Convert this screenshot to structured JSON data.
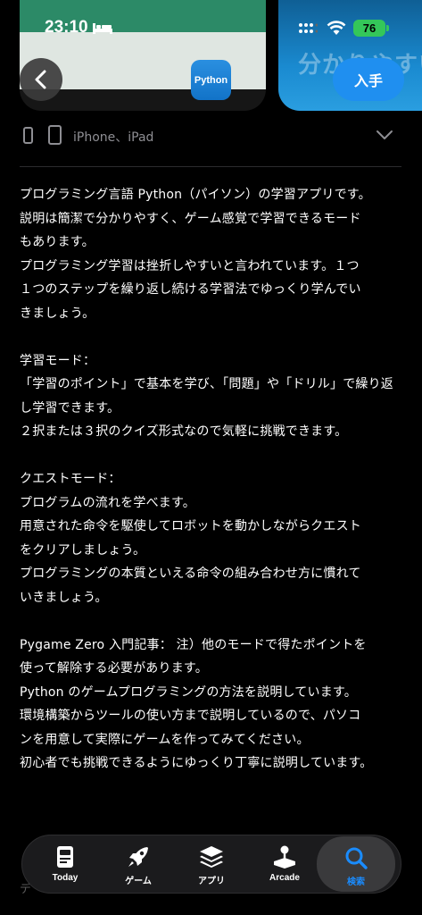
{
  "status_bar": {
    "time": "23:10",
    "battery": "76",
    "colors": {
      "battery": "#34c759"
    }
  },
  "screenshot_preview": {
    "ghost_text": "分かりやすい"
  },
  "header": {
    "app_icon_label": "Python",
    "get_button_label": "入手",
    "colors": {
      "accent": "#1f8ff0"
    }
  },
  "devices": {
    "label": "iPhone、iPad"
  },
  "description": {
    "text": "プログラミング言語 Python（パイソン）の学習アプリです。\n説明は簡潔で分かりやすく、ゲーム感覚で学習できるモード\nもあります。\nプログラミング学習は挫折しやすいと言われています。１つ\n１つのステップを繰り返し続ける学習法でゆっくり学んでい\nきましょう。\n\n学習モード：\n「学習のポイント」で基本を学び、「問題」や「ドリル」で繰り返\nし学習できます。\n２択または３択のクイズ形式なので気軽に挑戦できます。\n\nクエストモード：\nプログラムの流れを学べます。\n用意された命令を駆使してロボットを動かしながらクエスト\nをクリアしましょう。\nプログラミングの本質といえる命令の組み合わせ方に慣れて\nいきましょう。\n\nPygame Zero 入門記事： 注）他のモードで得たポイントを\n使って解除する必要があります。\nPython のゲームプログラミングの方法を説明しています。\n環境構築からツールの使い方まで説明しているので、パソコ\nンを用意して実際にゲームを作ってみてください。\n初心者でも挑戦できるようにゆっくり丁寧に説明しています。"
  },
  "cut_text": "デ",
  "tab_bar": {
    "tabs": [
      {
        "label": "Today",
        "icon": "today-icon"
      },
      {
        "label": "ゲーム",
        "icon": "rocket-icon"
      },
      {
        "label": "アプリ",
        "icon": "layers-icon"
      },
      {
        "label": "Arcade",
        "icon": "joystick-icon"
      },
      {
        "label": "検索",
        "icon": "search-icon",
        "active": true
      }
    ],
    "colors": {
      "active": "#1a8cff"
    }
  }
}
